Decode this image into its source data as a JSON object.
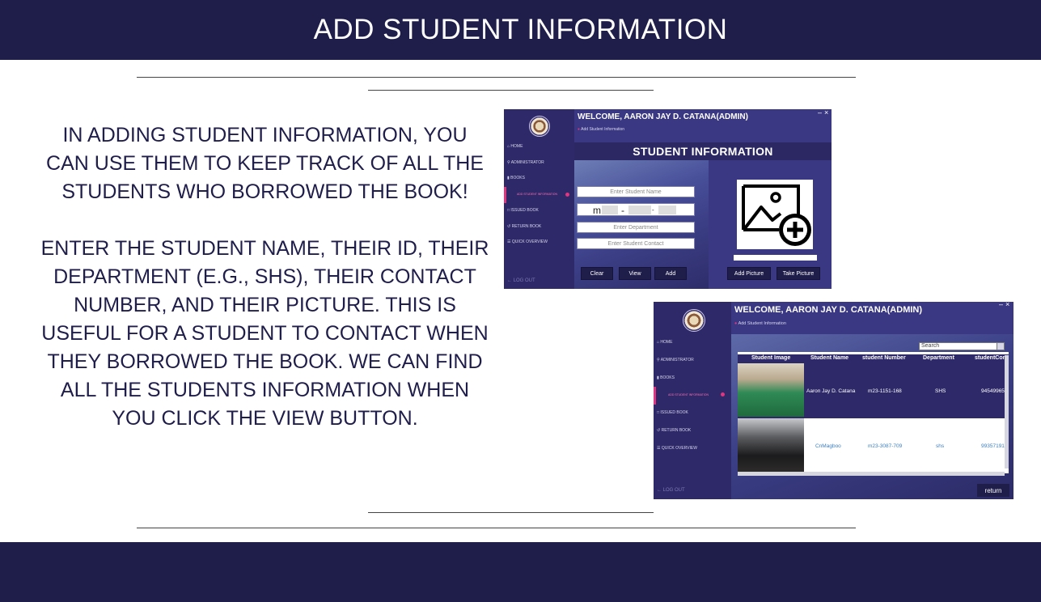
{
  "header": {
    "title": "ADD STUDENT INFORMATION"
  },
  "body": {
    "paragraph1": "IN ADDING STUDENT INFORMATION, YOU CAN USE THEM TO KEEP TRACK OF ALL THE STUDENTS WHO BORROWED THE BOOK!",
    "paragraph2": "ENTER THE STUDENT NAME, THEIR ID, THEIR DEPARTMENT (E.G., SHS), THEIR CONTACT NUMBER, AND THEIR PICTURE. THIS IS USEFUL FOR A STUDENT TO CONTACT WHEN THEY BORROWED THE BOOK. WE CAN FIND ALL THE STUDENTS INFORMATION WHEN YOU CLICK THE VIEW BUTTON."
  },
  "app": {
    "welcome": "WELCOME, AARON JAY D. CATANA(ADMIN)",
    "subtitle": "Add Student Information",
    "minimize": "–",
    "close": "×",
    "sidebar": [
      {
        "label": "HOME",
        "icon": "home-icon"
      },
      {
        "label": "ADMINISTRATOR",
        "icon": "key-icon"
      },
      {
        "label": "BOOKS",
        "icon": "book-icon"
      },
      {
        "label": "ADD STUDENT INFORMATION",
        "icon": "",
        "active": true
      },
      {
        "label": "ISSUED BOOK",
        "icon": "bookmark-icon"
      },
      {
        "label": "RETURN BOOK",
        "icon": "return-icon"
      },
      {
        "label": "QUICK OVERVIEW",
        "icon": "list-icon"
      }
    ],
    "logout": "LOG OUT"
  },
  "form": {
    "title": "STUDENT INFORMATION",
    "name_placeholder": "Enter Student Name",
    "id_prefix": "m",
    "id_sep1": "-",
    "id_sep2": "-",
    "department_placeholder": "Enter Department",
    "contact_placeholder": "Enter Student Contact",
    "buttons": {
      "clear": "Clear",
      "view": "View",
      "add": "Add",
      "add_picture": "Add Picture",
      "take_picture": "Take Picture"
    },
    "picture_icon": "add-image-icon"
  },
  "table": {
    "search": "Search",
    "columns": [
      "Student Image",
      "Student Name",
      "student Number",
      "Department",
      "studentCon"
    ],
    "rows": [
      {
        "name": "Aaron Jay D. Catana",
        "number": "m23-1151-168",
        "department": "SHS",
        "contact": "94549965"
      },
      {
        "name": "CnMagboo",
        "number": "m23-3087-709",
        "department": "shs",
        "contact": "99357191"
      }
    ],
    "return_label": "return"
  },
  "colors": {
    "navy": "#1f1d4a",
    "accent_pink": "#e0367f",
    "panel": "#3a3883"
  }
}
